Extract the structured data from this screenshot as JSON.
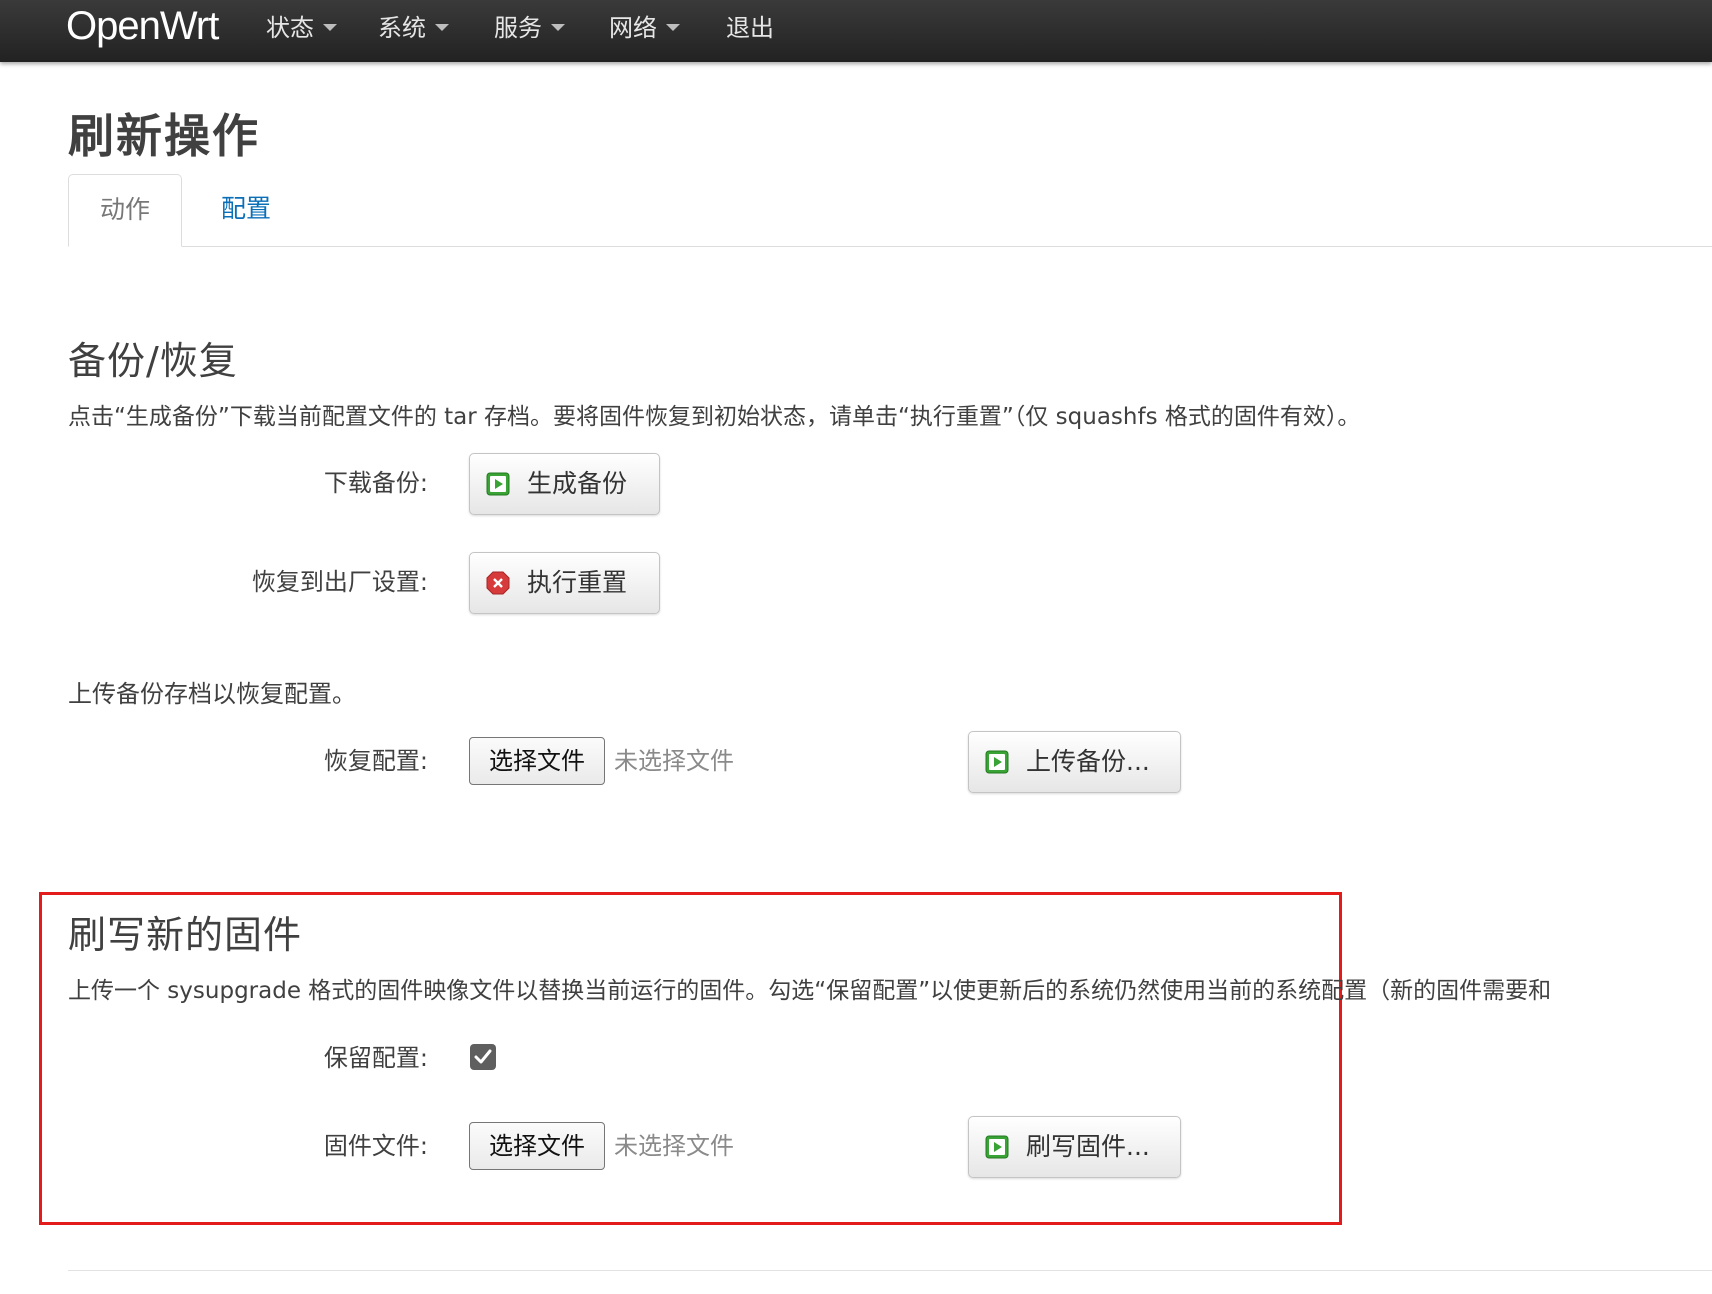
{
  "app": {
    "brand": "OpenWrt"
  },
  "nav": {
    "items": [
      {
        "label": "状态",
        "has_dropdown": true
      },
      {
        "label": "系统",
        "has_dropdown": true
      },
      {
        "label": "服务",
        "has_dropdown": true
      },
      {
        "label": "网络",
        "has_dropdown": true
      },
      {
        "label": "退出",
        "has_dropdown": false
      }
    ]
  },
  "page": {
    "title": "刷新操作"
  },
  "tabs": [
    {
      "label": "动作",
      "active": true
    },
    {
      "label": "配置",
      "active": false
    }
  ],
  "backup": {
    "title": "备份/恢复",
    "description": "点击“生成备份”下载当前配置文件的 tar 存档。要将固件恢复到初始状态，请单击“执行重置”（仅 squashfs 格式的固件有效）。",
    "download_label": "下载备份:",
    "download_button": "生成备份",
    "reset_label": "恢复到出厂设置:",
    "reset_button": "执行重置",
    "upload_hint": "上传备份存档以恢复配置。",
    "restore_label": "恢复配置:",
    "choose_file": "选择文件",
    "no_file": "未选择文件",
    "upload_button": "上传备份..."
  },
  "firmware": {
    "title": "刷写新的固件",
    "description": "上传一个 sysupgrade 格式的固件映像文件以替换当前运行的固件。勾选“保留配置”以使更新后的系统仍然使用当前的系统配置（新的固件需要和",
    "keep_label": "保留配置:",
    "keep_checked": true,
    "file_label": "固件文件:",
    "choose_file": "选择文件",
    "no_file": "未选择文件",
    "flash_button": "刷写固件..."
  },
  "colors": {
    "navbar": "#2b2b2b",
    "link": "#0b6fb8",
    "highlight_box": "#e31b1b",
    "icon_green": "#3aa335",
    "icon_red": "#d63a3a"
  },
  "icons": {
    "apply": "play-green-icon",
    "reset": "close-red-icon",
    "checkbox": "checkmark-icon"
  }
}
